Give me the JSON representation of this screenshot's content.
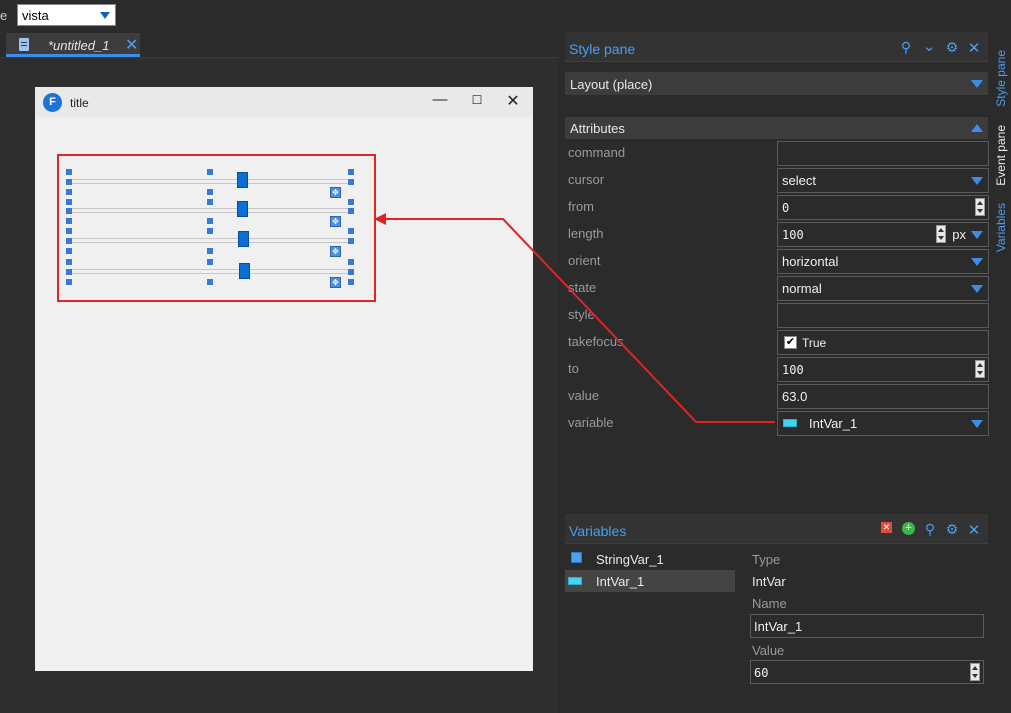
{
  "toolbar": {
    "theme_label_fragment": "e",
    "theme_value": "vista"
  },
  "tab": {
    "label": "*untitled_1",
    "close_glyph": "✕"
  },
  "design_window": {
    "title": "title",
    "logo_glyph": "F",
    "minimize_glyph": "—",
    "maximize_glyph": "☐",
    "close_glyph": "✕"
  },
  "style_pane": {
    "title": "Style pane",
    "layout_value": "Layout (place)",
    "attributes_label": "Attributes",
    "attributes": {
      "command": {
        "label": "command",
        "value": ""
      },
      "cursor": {
        "label": "cursor",
        "value": "select"
      },
      "from": {
        "label": "from",
        "value": "0"
      },
      "length": {
        "label": "length",
        "value": "100",
        "unit": "px"
      },
      "orient": {
        "label": "orient",
        "value": "horizontal"
      },
      "state": {
        "label": "state",
        "value": "normal"
      },
      "style": {
        "label": "style",
        "value": ""
      },
      "takefocus": {
        "label": "takefocus",
        "value": "True",
        "checked": true
      },
      "to": {
        "label": "to",
        "value": "100"
      },
      "value": {
        "label": "value",
        "value": "63.0"
      },
      "variable": {
        "label": "variable",
        "value": "IntVar_1"
      }
    }
  },
  "side_tabs": {
    "style_pane": "Style pane",
    "event_pane": "Event pane",
    "variables": "Variables"
  },
  "variables_pane": {
    "title": "Variables",
    "items": [
      {
        "name": "StringVar_1",
        "selected": false
      },
      {
        "name": "IntVar_1",
        "selected": true
      }
    ],
    "type_label": "Type",
    "type_value": "IntVar",
    "name_label": "Name",
    "name_value": "IntVar_1",
    "value_label": "Value",
    "value_value": "60"
  },
  "colors": {
    "accent": "#3b8ee8",
    "selection_border": "#e02424",
    "thumb": "#0a6fd6"
  },
  "icons": [
    "search-icon",
    "chevron-down-icon",
    "gear-icon",
    "close-icon",
    "delete-icon",
    "add-icon",
    "move-icon"
  ]
}
